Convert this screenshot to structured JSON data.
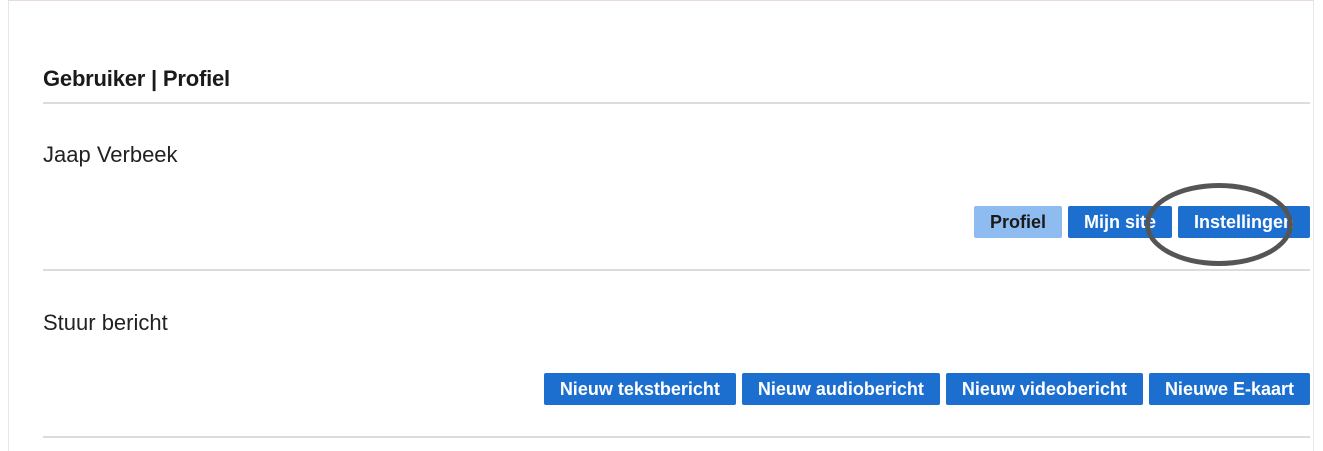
{
  "header": {
    "title": "Gebruiker | Profiel"
  },
  "profile": {
    "name": "Jaap Verbeek",
    "buttons": [
      {
        "label": "Profiel",
        "state": "active"
      },
      {
        "label": "Mijn site",
        "state": "default"
      },
      {
        "label": "Instellingen",
        "state": "default",
        "highlighted": true
      }
    ]
  },
  "message": {
    "title": "Stuur bericht",
    "buttons": [
      {
        "label": "Nieuw tekstbericht"
      },
      {
        "label": "Nieuw audiobericht"
      },
      {
        "label": "Nieuw videobericht"
      },
      {
        "label": "Nieuwe E-kaart"
      }
    ]
  },
  "colors": {
    "button_primary": "#1d6fcf",
    "button_active": "#8fbcf0",
    "annotation_ring": "#555555",
    "divider": "#dcdcdc"
  }
}
